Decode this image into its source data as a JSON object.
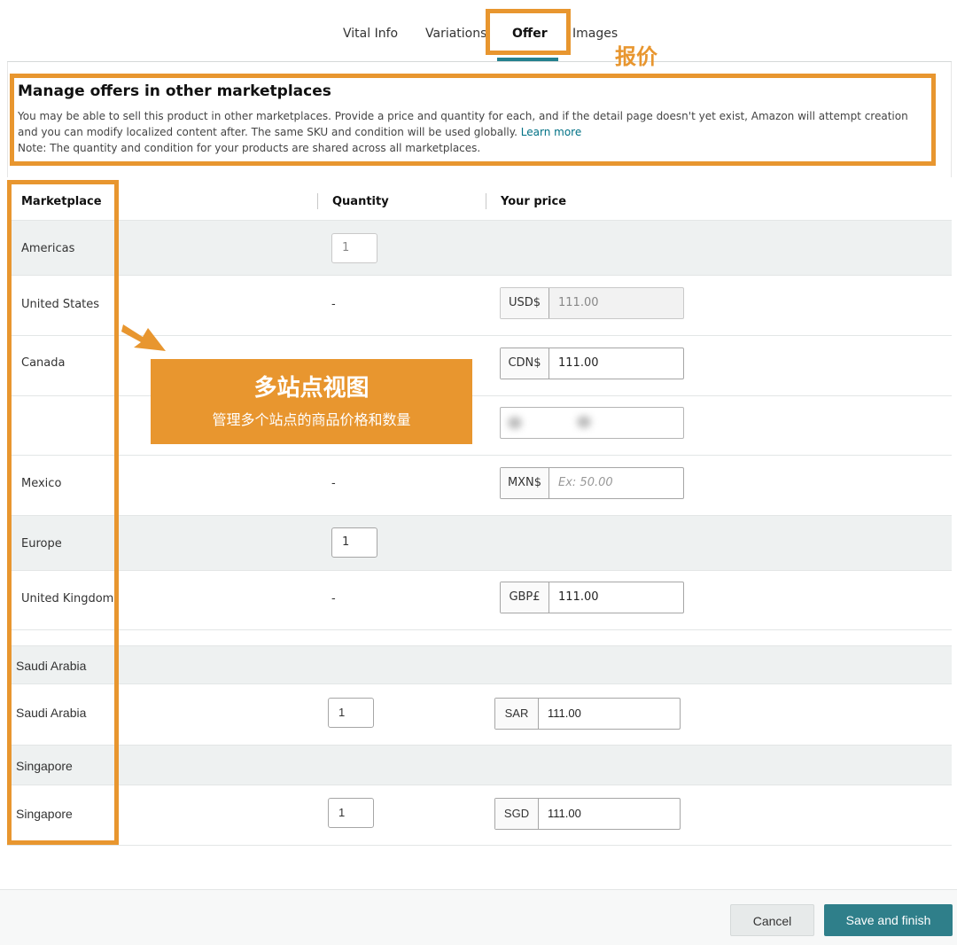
{
  "tabs": [
    {
      "label": "Vital Info"
    },
    {
      "label": "Variations"
    },
    {
      "label": "Offer"
    },
    {
      "label": "Images"
    }
  ],
  "annotation_offer_label": "报价",
  "header": {
    "title": "Manage offers in other marketplaces",
    "description": "You may be able to sell this product in other marketplaces. Provide a price and quantity for each, and if the detail page doesn't yet exist, Amazon will attempt creation and you can modify localized content after. The same SKU and condition will be used globally.",
    "learn_more": "Learn more",
    "note": "Note: The quantity and condition for your products are shared across all marketplaces."
  },
  "table": {
    "col_marketplace": "Marketplace",
    "col_quantity": "Quantity",
    "col_price": "Your price",
    "rows": [
      {
        "marketplace": "Americas",
        "quantity": "1"
      },
      {
        "marketplace": "United States",
        "quantity": "-",
        "currency": "USD$",
        "price": "111.00"
      },
      {
        "marketplace": "Canada",
        "currency": "CDN$",
        "price": "111.00"
      },
      {
        "marketplace": "Mexico",
        "quantity": "-",
        "currency": "MXN$",
        "price_placeholder": "Ex: 50.00"
      },
      {
        "marketplace": "Europe",
        "quantity": "1"
      },
      {
        "marketplace": "United Kingdom",
        "quantity": "-",
        "currency": "GBP£",
        "price": "111.00"
      },
      {
        "marketplace": "Saudi Arabia"
      },
      {
        "marketplace": "Saudi Arabia",
        "quantity": "1",
        "currency": "SAR",
        "price": "111.00"
      },
      {
        "marketplace": "Singapore"
      },
      {
        "marketplace": "Singapore",
        "quantity": "1",
        "currency": "SGD",
        "price": "111.00"
      }
    ]
  },
  "callout": {
    "title": "多站点视图",
    "subtitle": "管理多个站点的商品价格和数量"
  },
  "footer": {
    "cancel": "Cancel",
    "save": "Save and finish"
  },
  "colors": {
    "highlight": "#e8962f",
    "accent_teal": "#2f7f8a",
    "link": "#007185"
  }
}
